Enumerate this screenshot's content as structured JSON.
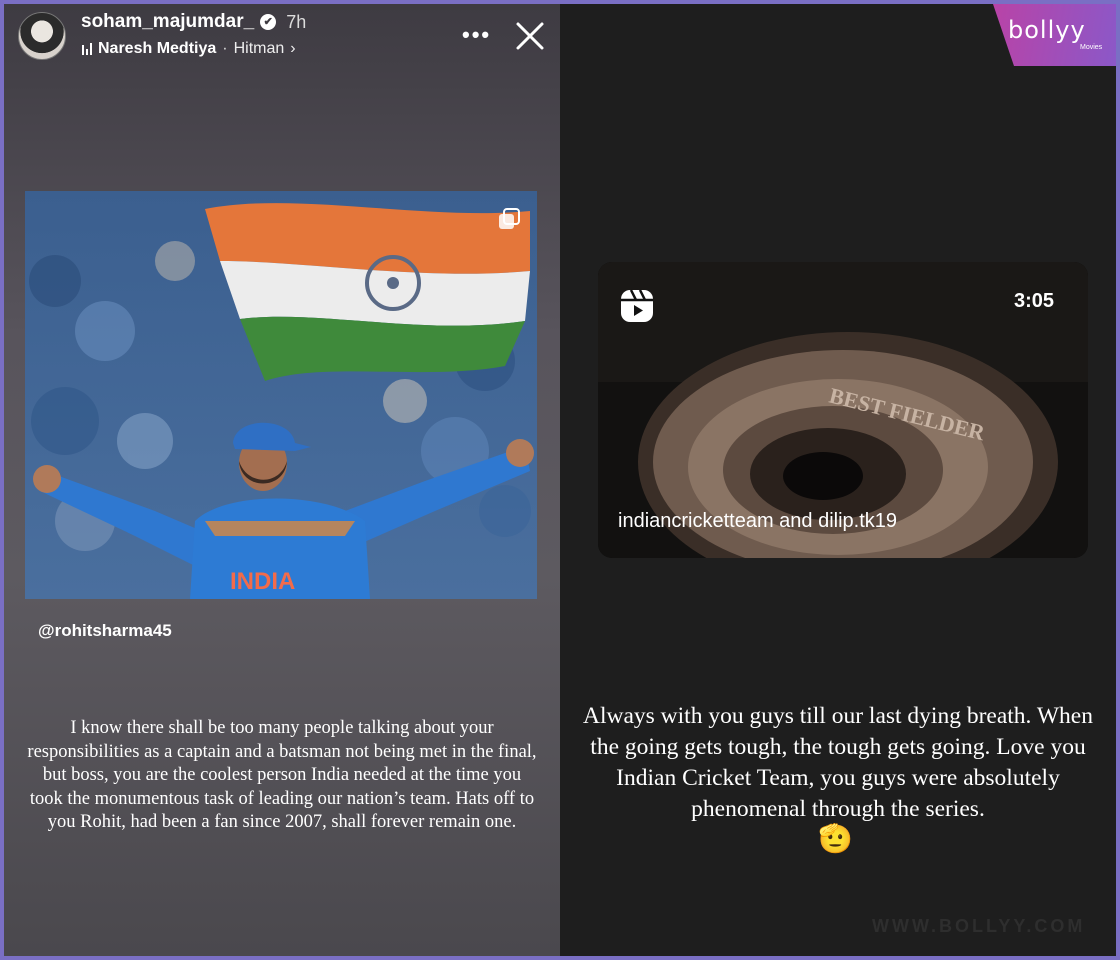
{
  "left_story": {
    "username": "soham_majumdar_",
    "verified_badge": "✔",
    "time": "7h",
    "music": {
      "artist": "Naresh Medtiya",
      "separator": "·",
      "track": "Hitman",
      "chevron": "›"
    },
    "more_label": "•••",
    "shared_post": {
      "image_alt_icons": [
        "multiple-photos-icon"
      ],
      "jersey_text": "INDIA"
    },
    "mention": "@rohitsharma45",
    "caption": "I know there shall be too many people talking about your responsibilities as a captain and a batsman not being met in the final, but boss, you are the coolest person India needed at the time you took the monumentous task of leading our nation’s team. Hats off to you Rohit, had been a fan since 2007, shall forever remain one."
  },
  "right_story": {
    "logo": "bollyy",
    "logo_sub": "Movies",
    "reel": {
      "duration": "3:05",
      "credit": "indiancricketteam and dilip.tk19"
    },
    "caption": "Always with you guys till our last dying breath. When the going gets tough, the tough gets going. Love you Indian Cricket Team, you guys were absolutely phenomenal through the series.",
    "emoji": "🫡",
    "watermark": "WWW.BOLLYY.COM"
  },
  "colors": {
    "page_border": "#7a6fc4",
    "left_bg": "#58545c",
    "right_bg": "#1e1e1e",
    "logo_gradient_start": "#c23fa0",
    "logo_gradient_end": "#8b58c8"
  }
}
